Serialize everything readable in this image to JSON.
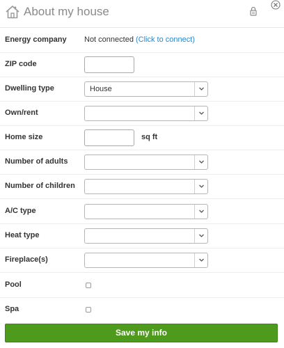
{
  "header": {
    "title": "About my house",
    "icons": {
      "house": "house-icon",
      "lock": "lock-icon",
      "close": "close-icon"
    }
  },
  "form": {
    "energy_company": {
      "label": "Energy company",
      "status": "Not connected",
      "link": "(Click to connect)"
    },
    "zip_code": {
      "label": "ZIP code",
      "value": ""
    },
    "dwelling_type": {
      "label": "Dwelling type",
      "value": "House"
    },
    "own_rent": {
      "label": "Own/rent",
      "value": ""
    },
    "home_size": {
      "label": "Home size",
      "value": "",
      "unit": "sq ft"
    },
    "num_adults": {
      "label": "Number of adults",
      "value": ""
    },
    "num_children": {
      "label": "Number of children",
      "value": ""
    },
    "ac_type": {
      "label": "A/C type",
      "value": ""
    },
    "heat_type": {
      "label": "Heat type",
      "value": ""
    },
    "fireplaces": {
      "label": "Fireplace(s)",
      "value": ""
    },
    "pool": {
      "label": "Pool",
      "checked": false
    },
    "spa": {
      "label": "Spa",
      "checked": false
    }
  },
  "actions": {
    "save_label": "Save my info"
  },
  "colors": {
    "accent": "#4e9a1c",
    "link": "#2b86c6",
    "title": "#8a8a8a"
  }
}
